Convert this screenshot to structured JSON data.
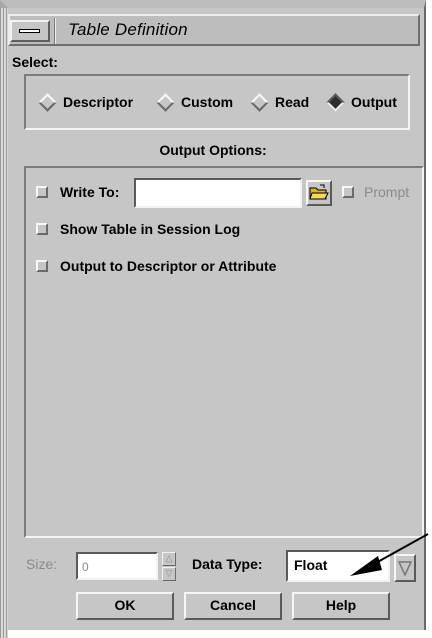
{
  "window": {
    "title": "Table Definition"
  },
  "select": {
    "label": "Select:",
    "options": [
      {
        "label": "Descriptor",
        "selected": false
      },
      {
        "label": "Custom",
        "selected": false
      },
      {
        "label": "Read",
        "selected": false
      },
      {
        "label": "Output",
        "selected": true
      }
    ]
  },
  "output_options": {
    "label": "Output Options:",
    "write_to": {
      "label": "Write To:",
      "value": "",
      "checked": false
    },
    "prompt": {
      "label": "Prompt",
      "checked": false,
      "enabled": false
    },
    "show_table": {
      "label": "Show Table in Session Log",
      "checked": false
    },
    "output_to": {
      "label": "Output to Descriptor or Attribute",
      "checked": false
    }
  },
  "size": {
    "label": "Size:",
    "value": "0",
    "enabled": false
  },
  "data_type": {
    "label": "Data Type:",
    "value": "Float"
  },
  "buttons": {
    "ok": "OK",
    "cancel": "Cancel",
    "help": "Help"
  },
  "icons": {
    "menu": "window-menu-icon",
    "folder": "folder-open-icon",
    "dropdown": "triangle-down-icon",
    "spin_up": "triangle-up-icon",
    "spin_down": "triangle-down-icon",
    "annotation": "arrow-icon"
  },
  "colors": {
    "window_bg": "#c6c6c6",
    "field_bg": "#ffffff",
    "folder": "#e8c94a"
  }
}
